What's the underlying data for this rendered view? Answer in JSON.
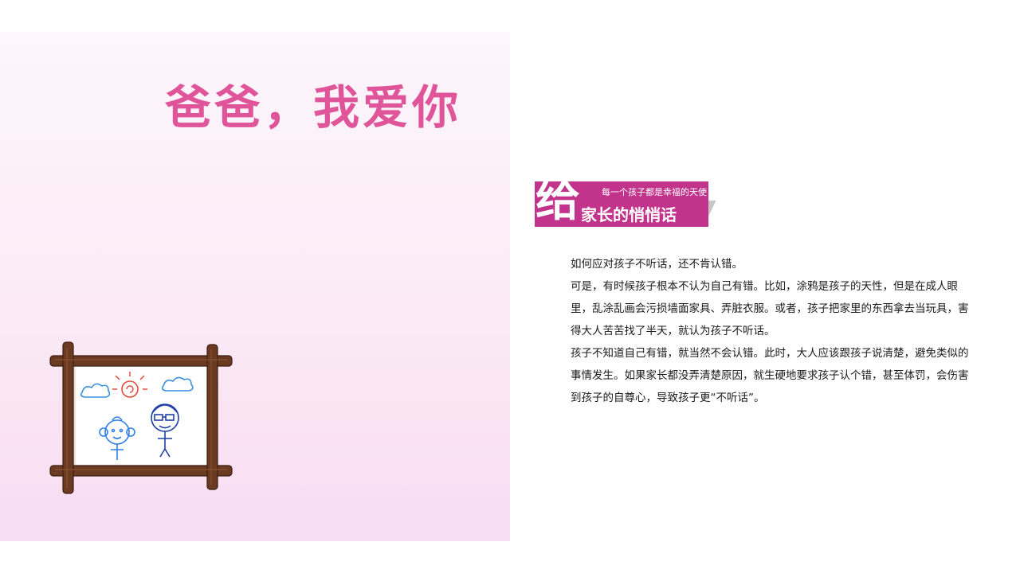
{
  "left": {
    "title": "爸爸，我爱你"
  },
  "banner": {
    "big_char": "给",
    "small_line": "每一个孩子都是幸福的天使",
    "main_line": "家长的悄悄话"
  },
  "article": {
    "paragraphs": [
      "如何应对孩子不听话，还不肯认错。",
      "可是，有时候孩子根本不认为自己有错。比如，涂鸦是孩子的天性，但是在成人眼里，乱涂乱画会污损墙面家具、弄脏衣服。或者，孩子把家里的东西拿去当玩具，害得大人苦苦找了半天，就认为孩子不听话。",
      "孩子不知道自己有错，就当然不会认错。此时，大人应该跟孩子说清楚，避免类似的事情发生。如果家长都没弄清楚原因，就生硬地要求孩子认个错，甚至体罚，会伤害到孩子的自尊心，导致孩子更“不听话”。"
    ]
  },
  "colors": {
    "title_pink": "#e0559a",
    "banner_magenta": "#c2338c"
  },
  "illustration": {
    "icon": "picture-frame-drawing-icon"
  }
}
